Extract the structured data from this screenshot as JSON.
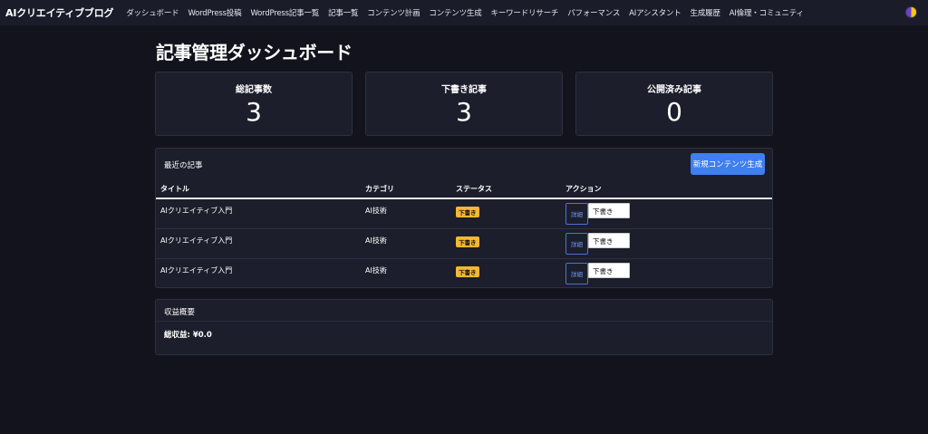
{
  "nav": {
    "brand": "AIクリエイティブブログ",
    "items": [
      "ダッシュボード",
      "WordPress投稿",
      "WordPress記事一覧",
      "記事一覧",
      "コンテンツ計画",
      "コンテンツ生成",
      "キーワードリサーチ",
      "パフォーマンス",
      "AIアシスタント",
      "生成履歴",
      "AI倫理・コミュニティ"
    ]
  },
  "page": {
    "title": "記事管理ダッシュボード"
  },
  "stats": [
    {
      "label": "総記事数",
      "value": "3"
    },
    {
      "label": "下書き記事",
      "value": "3"
    },
    {
      "label": "公開済み記事",
      "value": "0"
    }
  ],
  "recent": {
    "title": "最近の記事",
    "new_button": "新規コンテンツ生成",
    "columns": [
      "タイトル",
      "カテゴリ",
      "ステータス",
      "アクション"
    ],
    "rows": [
      {
        "title": "AIクリエイティブ入門",
        "category": "AI技術",
        "status": "下書き",
        "detail": "詳細",
        "select": "下書き"
      },
      {
        "title": "AIクリエイティブ入門",
        "category": "AI技術",
        "status": "下書き",
        "detail": "詳細",
        "select": "下書き"
      },
      {
        "title": "AIクリエイティブ入門",
        "category": "AI技術",
        "status": "下書き",
        "detail": "詳細",
        "select": "下書き"
      }
    ]
  },
  "revenue": {
    "title": "収益概要",
    "total": "総収益: ¥0.0"
  },
  "colors": {
    "background": "#12131c",
    "navbar": "#1a1c29",
    "card": "#1c1e2b",
    "accent": "#3f7ff0",
    "badge": "#f5b82e"
  }
}
